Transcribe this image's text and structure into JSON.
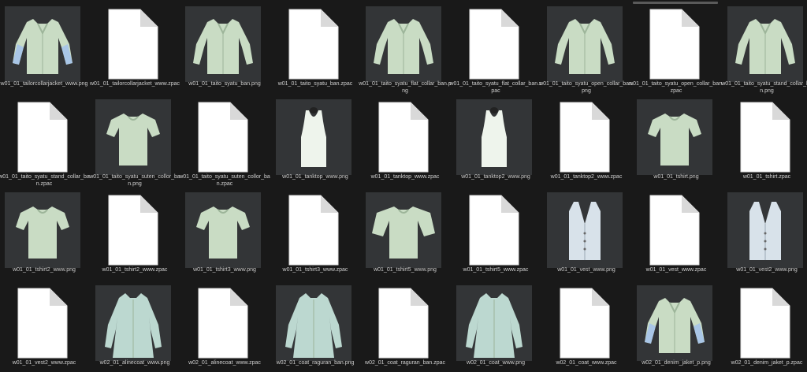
{
  "files": [
    {
      "name": "w01_01_tailorcollarjacket_www.png",
      "kind": "png",
      "garment": "jacket"
    },
    {
      "name": "w01_01_tailorcollarjacket_www.zpac",
      "kind": "zpac"
    },
    {
      "name": "w01_01_taito_syatu_ban.png",
      "kind": "png",
      "garment": "shirt-long"
    },
    {
      "name": "w01_01_taito_syatu_ban.zpac",
      "kind": "zpac"
    },
    {
      "name": "w01_01_taito_syatu_flat_collar_ban.png",
      "kind": "png",
      "garment": "shirt-long"
    },
    {
      "name": "w01_01_taito_syatu_flat_collar_ban.zpac",
      "kind": "zpac"
    },
    {
      "name": "w01_01_taito_syatu_open_collar_ban.png",
      "kind": "png",
      "garment": "shirt-long"
    },
    {
      "name": "w01_01_taito_syatu_open_collar_ban.zpac",
      "kind": "zpac"
    },
    {
      "name": "w01_01_taito_syatu_stand_collar_ban.png",
      "kind": "png",
      "garment": "shirt-long"
    },
    {
      "name": "w01_01_taito_syatu_stand_collar_ban.zpac",
      "kind": "zpac"
    },
    {
      "name": "w01_01_taito_syatu_suten_collor_ban.png",
      "kind": "png",
      "garment": "shirt-short"
    },
    {
      "name": "w01_01_taito_syatu_suten_collor_ban.zpac",
      "kind": "zpac"
    },
    {
      "name": "w01_01_tanktop_www.png",
      "kind": "png",
      "garment": "tank"
    },
    {
      "name": "w01_01_tanktop_www.zpac",
      "kind": "zpac"
    },
    {
      "name": "w01_01_tanktop2_www.png",
      "kind": "png",
      "garment": "tank"
    },
    {
      "name": "w01_01_tanktop2_www.zpac",
      "kind": "zpac"
    },
    {
      "name": "w01_01_tshirt.png",
      "kind": "png",
      "garment": "tshirt"
    },
    {
      "name": "w01_01_tshirt.zpac",
      "kind": "zpac"
    },
    {
      "name": "w01_01_tshirt2_www.png",
      "kind": "png",
      "garment": "tshirt"
    },
    {
      "name": "w01_01_tshirt2_www.zpac",
      "kind": "zpac"
    },
    {
      "name": "w01_01_tshirt3_www.png",
      "kind": "png",
      "garment": "tshirt"
    },
    {
      "name": "w01_01_tshirt3_www.zpac",
      "kind": "zpac"
    },
    {
      "name": "w01_01_tshirt5_www.png",
      "kind": "png",
      "garment": "tshirt-wide"
    },
    {
      "name": "w01_01_tshirt5_www.zpac",
      "kind": "zpac"
    },
    {
      "name": "w01_01_vest_www.png",
      "kind": "png",
      "garment": "vest"
    },
    {
      "name": "w01_01_vest_www.zpac",
      "kind": "zpac"
    },
    {
      "name": "w01_01_vest2_www.png",
      "kind": "png",
      "garment": "vest"
    },
    {
      "name": "w01_01_vest2_www.zpac",
      "kind": "zpac"
    },
    {
      "name": "w02_01_alinecoat_www.png",
      "kind": "png",
      "garment": "coat"
    },
    {
      "name": "w02_01_alinecoat_www.zpac",
      "kind": "zpac"
    },
    {
      "name": "w02_01_coat_raguran_ban.png",
      "kind": "png",
      "garment": "coat"
    },
    {
      "name": "w02_01_coat_raguran_ban.zpac",
      "kind": "zpac"
    },
    {
      "name": "w02_01_coat_www.png",
      "kind": "png",
      "garment": "coat"
    },
    {
      "name": "w02_01_coat_www.zpac",
      "kind": "zpac"
    },
    {
      "name": "w02_01_denim_jaket_p.png",
      "kind": "png",
      "garment": "jacket"
    },
    {
      "name": "w02_01_denim_jaket_p.zpac",
      "kind": "zpac"
    }
  ],
  "colors": {
    "background": "#191919",
    "thumb_bg": "#333537",
    "label_text": "#cfcfcf",
    "garment_fill": "#c9dcc4",
    "garment_shade": "#9db59a",
    "doc_fill": "#ffffff",
    "doc_fold": "#d9d9d9"
  }
}
